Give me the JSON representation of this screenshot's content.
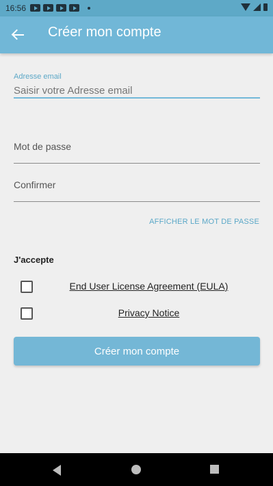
{
  "status_bar": {
    "time": "16:56"
  },
  "app_bar": {
    "title": "Créer mon compte"
  },
  "email": {
    "label": "Adresse email",
    "placeholder": "Saisir votre Adresse email"
  },
  "password": {
    "label": "Mot de passe"
  },
  "confirm": {
    "label": "Confirmer"
  },
  "show_password": "AFFICHER LE MOT DE PASSE",
  "accept": {
    "heading": "J'accepte",
    "items": [
      {
        "label": "End User License Agreement (EULA)"
      },
      {
        "label": "Privacy Notice"
      }
    ]
  },
  "submit_label": "Créer mon compte"
}
